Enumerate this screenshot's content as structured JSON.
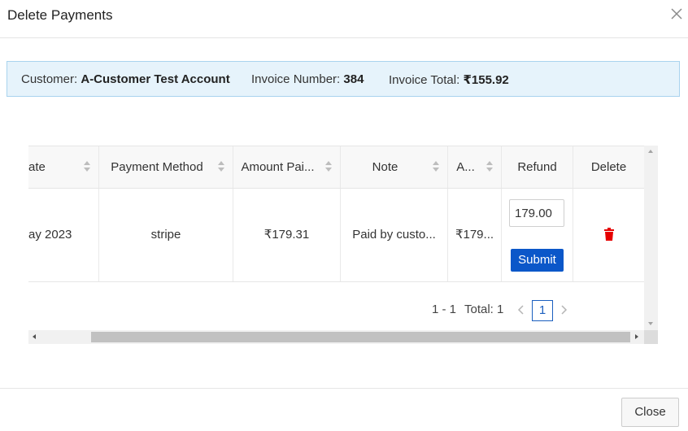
{
  "dialog": {
    "title": "Delete Payments",
    "close_icon": "close-x-icon"
  },
  "info": {
    "customer_label": "Customer:",
    "customer_value": "A-Customer Test Account",
    "invoice_number_label": "Invoice Number:",
    "invoice_number_value": "384",
    "invoice_total_label": "Invoice Total:",
    "invoice_total_value": "₹155.92"
  },
  "table": {
    "columns": [
      {
        "label": "ate",
        "sortable": true
      },
      {
        "label": "Payment Method",
        "sortable": true
      },
      {
        "label": "Amount Pai...",
        "sortable": true
      },
      {
        "label": "Note",
        "sortable": true
      },
      {
        "label": "A...",
        "sortable": true
      },
      {
        "label": "Refund",
        "sortable": false
      },
      {
        "label": "Delete",
        "sortable": false
      }
    ],
    "rows": [
      {
        "date": "ay 2023",
        "payment_method": "stripe",
        "amount_paid": "₹179.31",
        "note": "Paid by custo...",
        "amount": "₹179...",
        "refund_value": "179.00",
        "submit_label": "Submit",
        "delete_icon": "trash-icon"
      }
    ]
  },
  "pager": {
    "range": "1 - 1",
    "total": "Total: 1",
    "current_page": "1"
  },
  "footer": {
    "close_label": "Close"
  },
  "colors": {
    "info_bg": "#e6f3fb",
    "info_border": "#a9d3ee",
    "submit_bg": "#0b57c9",
    "delete_icon": "#e60000",
    "pager_active": "#1b5fbf"
  }
}
